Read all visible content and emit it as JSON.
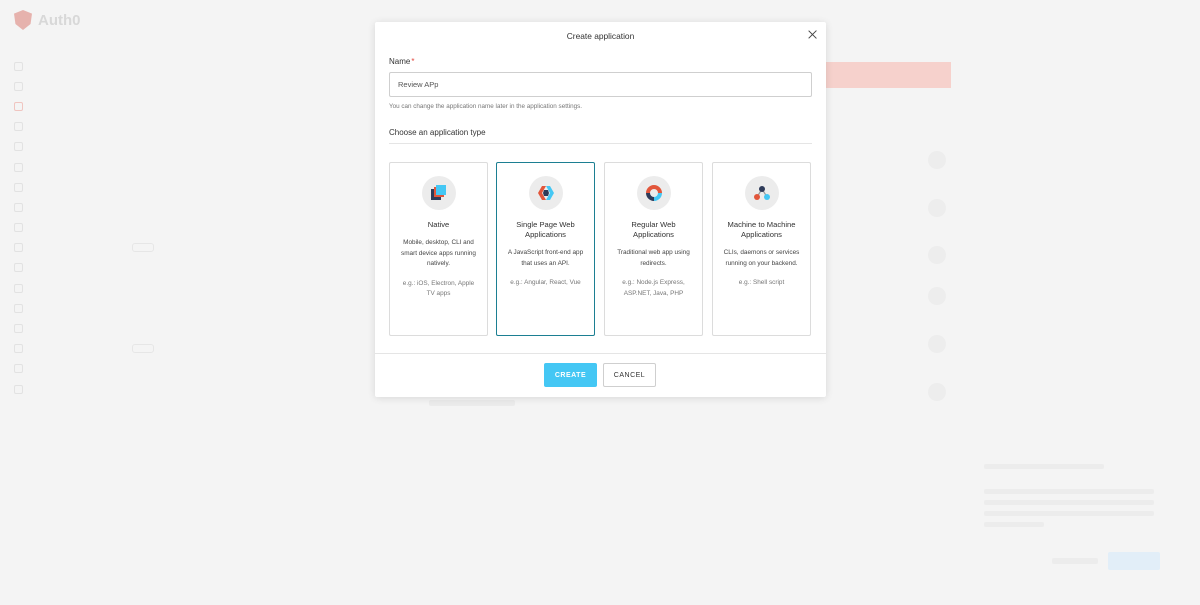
{
  "modal": {
    "title": "Create application",
    "name_label": "Name",
    "required_mark": "*",
    "name_value": "Review APp",
    "name_help": "You can change the application name later in the application settings.",
    "type_section_title": "Choose an application type",
    "types": [
      {
        "title": "Native",
        "description": "Mobile, desktop, CLI and smart device apps running natively.",
        "example": "e.g.: iOS, Electron, Apple TV apps",
        "icon": "native-app-icon",
        "selected": false
      },
      {
        "title": "Single Page Web Applications",
        "description": "A JavaScript front-end app that uses an API.",
        "example": "e.g.: Angular, React, Vue",
        "icon": "spa-icon",
        "selected": true
      },
      {
        "title": "Regular Web Applications",
        "description": "Traditional web app using redirects.",
        "example": "e.g.: Node.js Express, ASP.NET, Java, PHP",
        "icon": "regular-web-app-icon",
        "selected": false
      },
      {
        "title": "Machine to Machine Applications",
        "description": "CLIs, daemons or services running on your backend.",
        "example": "e.g.: Shell script",
        "icon": "m2m-app-icon",
        "selected": false
      }
    ],
    "create_label": "CREATE",
    "cancel_label": "CANCEL"
  },
  "background": {
    "logo_text": "Auth0"
  },
  "colors": {
    "accent": "#44c7f4",
    "selected_border": "#1c7f92",
    "required": "#e2463d"
  }
}
